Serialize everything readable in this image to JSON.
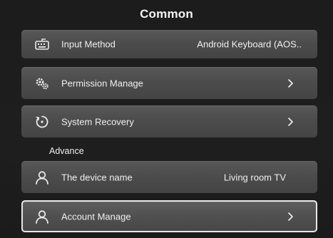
{
  "header": {
    "title": "Common"
  },
  "rows": [
    {
      "label": "Input Method",
      "value": "Android Keyboard (AOS..",
      "icon": "keyboard-icon"
    },
    {
      "label": "Permission Manage",
      "icon": "permission-gears-icon",
      "chevron": "chevron-right-icon"
    },
    {
      "label": "System Recovery",
      "icon": "recovery-icon",
      "chevron": "chevron-right-icon"
    }
  ],
  "advance": {
    "heading": "Advance",
    "rows": [
      {
        "label": "The device name",
        "value": "Living room TV",
        "icon": "user-icon"
      },
      {
        "label": "Account Manage",
        "icon": "user-icon",
        "chevron": "chevron-right-icon",
        "selected": true
      }
    ]
  },
  "colors": {
    "background": "#1c1c1c",
    "row": "#4e4e4e",
    "text": "#f0f0f0",
    "focus_border": "#e8e8e8"
  }
}
